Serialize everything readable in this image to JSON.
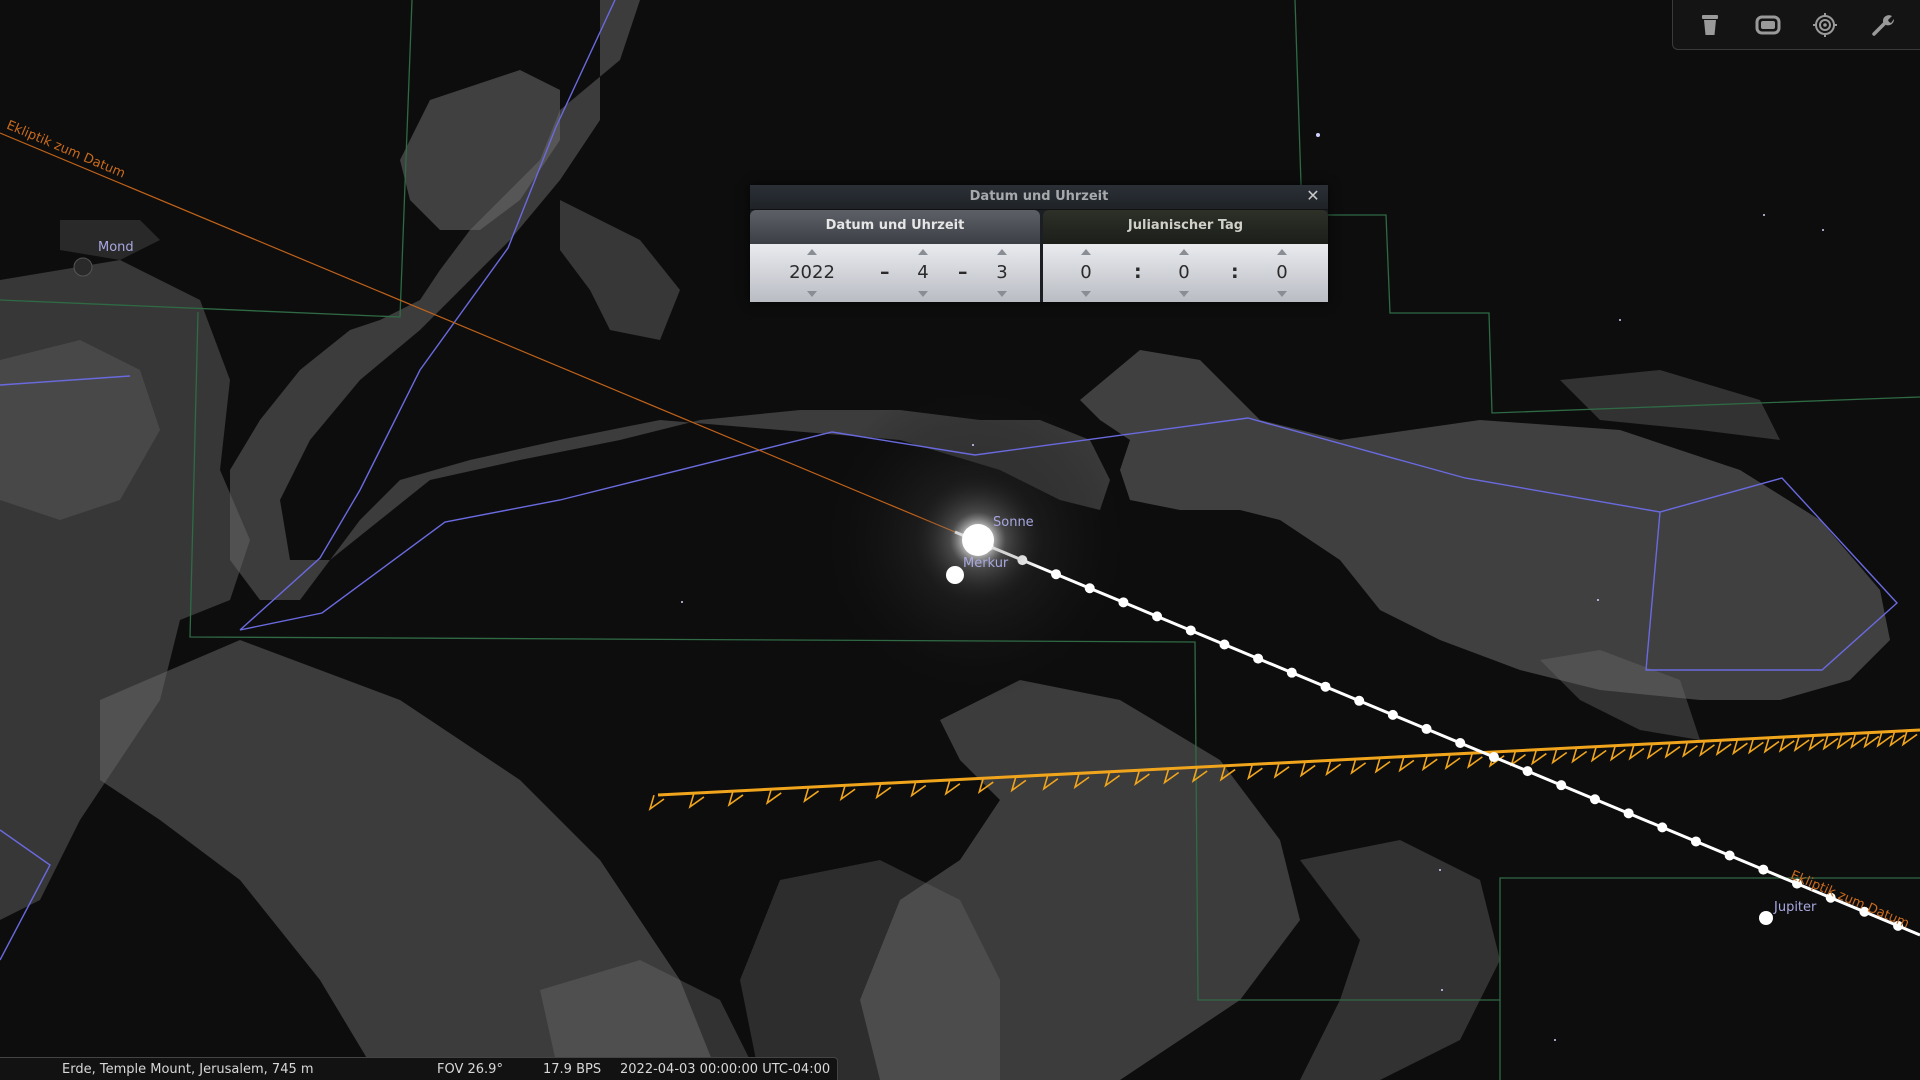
{
  "sky": {
    "labels": {
      "moon": "Mond",
      "sun": "Sonne",
      "mercury": "Merkur",
      "jupiter": "Jupiter",
      "ecliptic_left": "Ekliptik zum Datum",
      "ecliptic_right": "Ekliptik zum Datum"
    },
    "colors": {
      "constellation_lines": "#6a6ae0",
      "boundaries": "#2f6a45",
      "ecliptic": "#c0621a",
      "trail": "#f0a51c",
      "sun_path": "#ffffff"
    }
  },
  "toolbar": {
    "buttons": [
      {
        "name": "trash-icon"
      },
      {
        "name": "window-icon"
      },
      {
        "name": "target-icon"
      },
      {
        "name": "wrench-icon"
      }
    ]
  },
  "dialog": {
    "title": "Datum und Uhrzeit",
    "close_glyph": "✕",
    "tabs": [
      {
        "label": "Datum und Uhrzeit"
      },
      {
        "label": "Julianischer Tag"
      }
    ],
    "date": {
      "year": "2022",
      "month": "4",
      "day": "3",
      "separator": "–"
    },
    "time": {
      "hour": "0",
      "minute": "0",
      "second": "0",
      "separator": ":"
    }
  },
  "statusbar": {
    "location": "Erde, Temple Mount, Jerusalem, 745 m",
    "fov": "FOV 26.9°",
    "fps": "17.9 BPS",
    "datetime": "2022-04-03 00:00:00 UTC-04:00"
  }
}
